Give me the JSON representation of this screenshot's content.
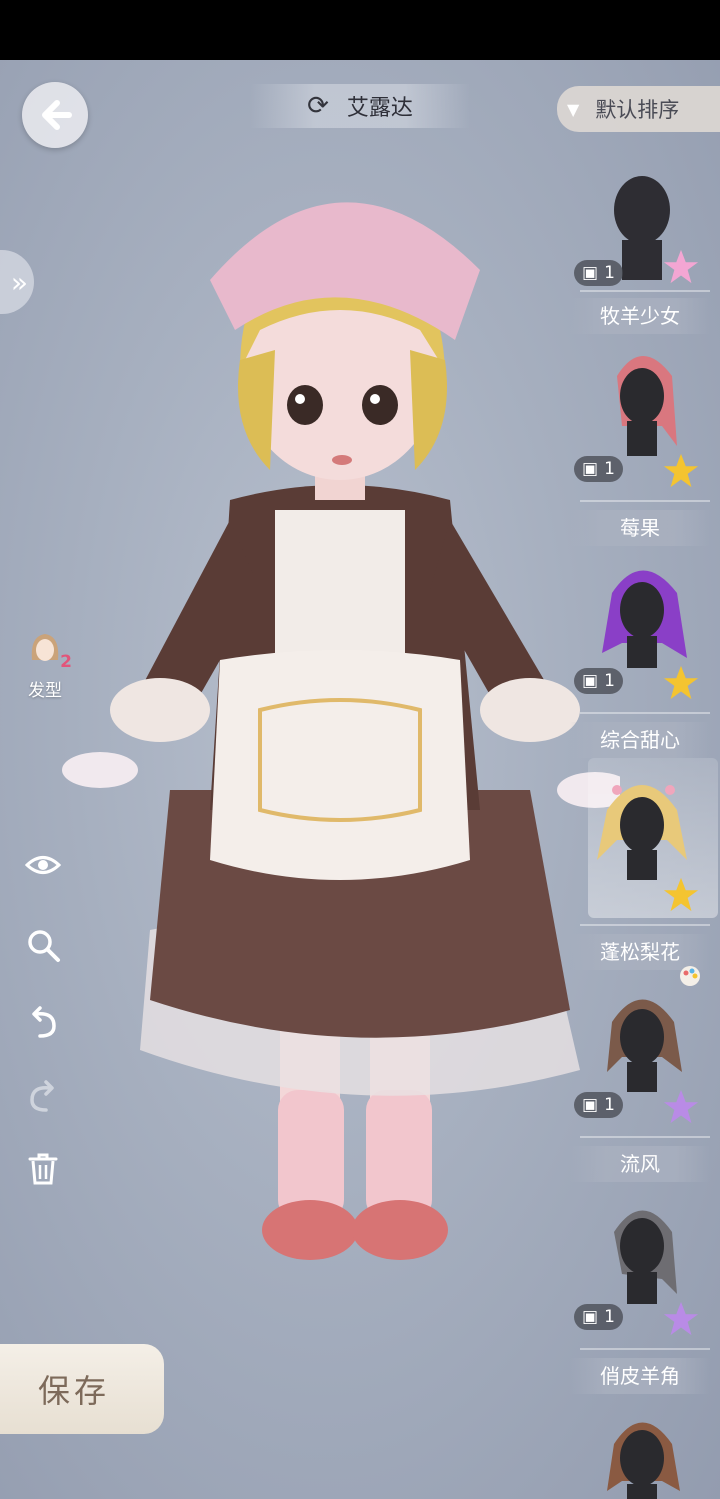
{
  "header": {
    "character_name": "艾露达",
    "sort_label": "默认排序"
  },
  "left_panel": {
    "hair_tab_label": "发型",
    "hair_tab_badge": "2"
  },
  "save_label": "保存",
  "hair_list": [
    {
      "name": "",
      "count": "1",
      "hair_color": "#2a2a2e",
      "star_color": "#f0a0d0"
    },
    {
      "name": "牧羊少女",
      "count": "1",
      "hair_color": "#d9777f",
      "star_color": "#f4c430"
    },
    {
      "name": "莓果",
      "count": "1",
      "hair_color": "#8a3fc7",
      "star_color": "#f4c430"
    },
    {
      "name": "综合甜心",
      "count": "",
      "hair_color": "#e8c97a",
      "star_color": "#f4c430"
    },
    {
      "name": "蓬松梨花",
      "count": "1",
      "hair_color": "#7b5a4a",
      "star_color": "#b98be6"
    },
    {
      "name": "流风",
      "count": "1",
      "hair_color": "#6e6d72",
      "star_color": "#b98be6"
    },
    {
      "name": "俏皮羊角",
      "count": "1",
      "hair_color": "#8a5a42",
      "star_color": "#b98be6"
    }
  ]
}
